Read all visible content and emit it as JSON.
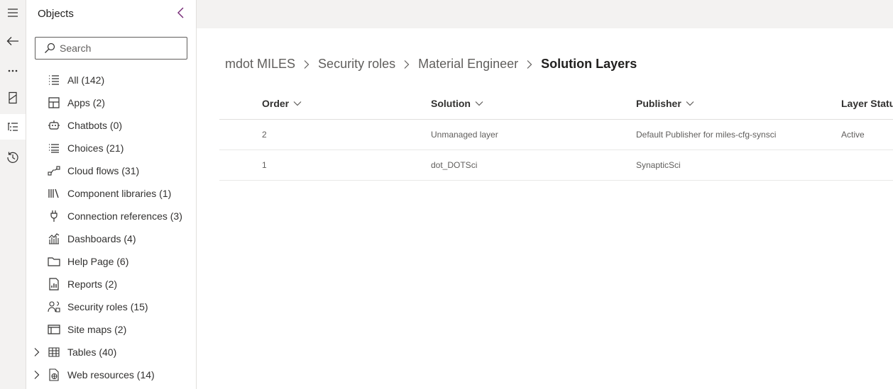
{
  "objects_panel": {
    "title": "Objects",
    "search_placeholder": "Search",
    "items": [
      {
        "label": "All  (142)",
        "icon": "list-bullets-icon",
        "expandable": false
      },
      {
        "label": "Apps  (2)",
        "icon": "apps-icon",
        "expandable": false
      },
      {
        "label": "Chatbots  (0)",
        "icon": "chatbot-icon",
        "expandable": false
      },
      {
        "label": "Choices  (21)",
        "icon": "choices-icon",
        "expandable": false
      },
      {
        "label": "Cloud flows  (31)",
        "icon": "cloud-flow-icon",
        "expandable": false
      },
      {
        "label": "Component libraries  (1)",
        "icon": "library-icon",
        "expandable": false
      },
      {
        "label": "Connection references  (3)",
        "icon": "plug-icon",
        "expandable": false
      },
      {
        "label": "Dashboards  (4)",
        "icon": "dashboard-icon",
        "expandable": false
      },
      {
        "label": "Help Page  (6)",
        "icon": "folder-icon",
        "expandable": false
      },
      {
        "label": "Reports  (2)",
        "icon": "report-icon",
        "expandable": false
      },
      {
        "label": "Security roles  (15)",
        "icon": "security-roles-icon",
        "expandable": false
      },
      {
        "label": "Site maps  (2)",
        "icon": "site-map-icon",
        "expandable": false
      },
      {
        "label": "Tables  (40)",
        "icon": "table-icon",
        "expandable": true
      },
      {
        "label": "Web resources  (14)",
        "icon": "web-resource-icon",
        "expandable": true
      }
    ]
  },
  "breadcrumb": {
    "items": [
      "mdot MILES",
      "Security roles",
      "Material Engineer",
      "Solution Layers"
    ]
  },
  "grid": {
    "columns": [
      "Order",
      "Solution",
      "Publisher",
      "Layer Status"
    ],
    "rows": [
      [
        "2",
        "Unmanaged layer",
        "Default Publisher for miles-cfg-synsci",
        "Active"
      ],
      [
        "1",
        "dot_DOTSci",
        "SynapticSci",
        ""
      ]
    ]
  },
  "colors": {
    "accent": "#742774",
    "rail_bg": "#f3f2f1",
    "topbar_bg": "#f3f2f1",
    "border": "#e1dfdd"
  }
}
